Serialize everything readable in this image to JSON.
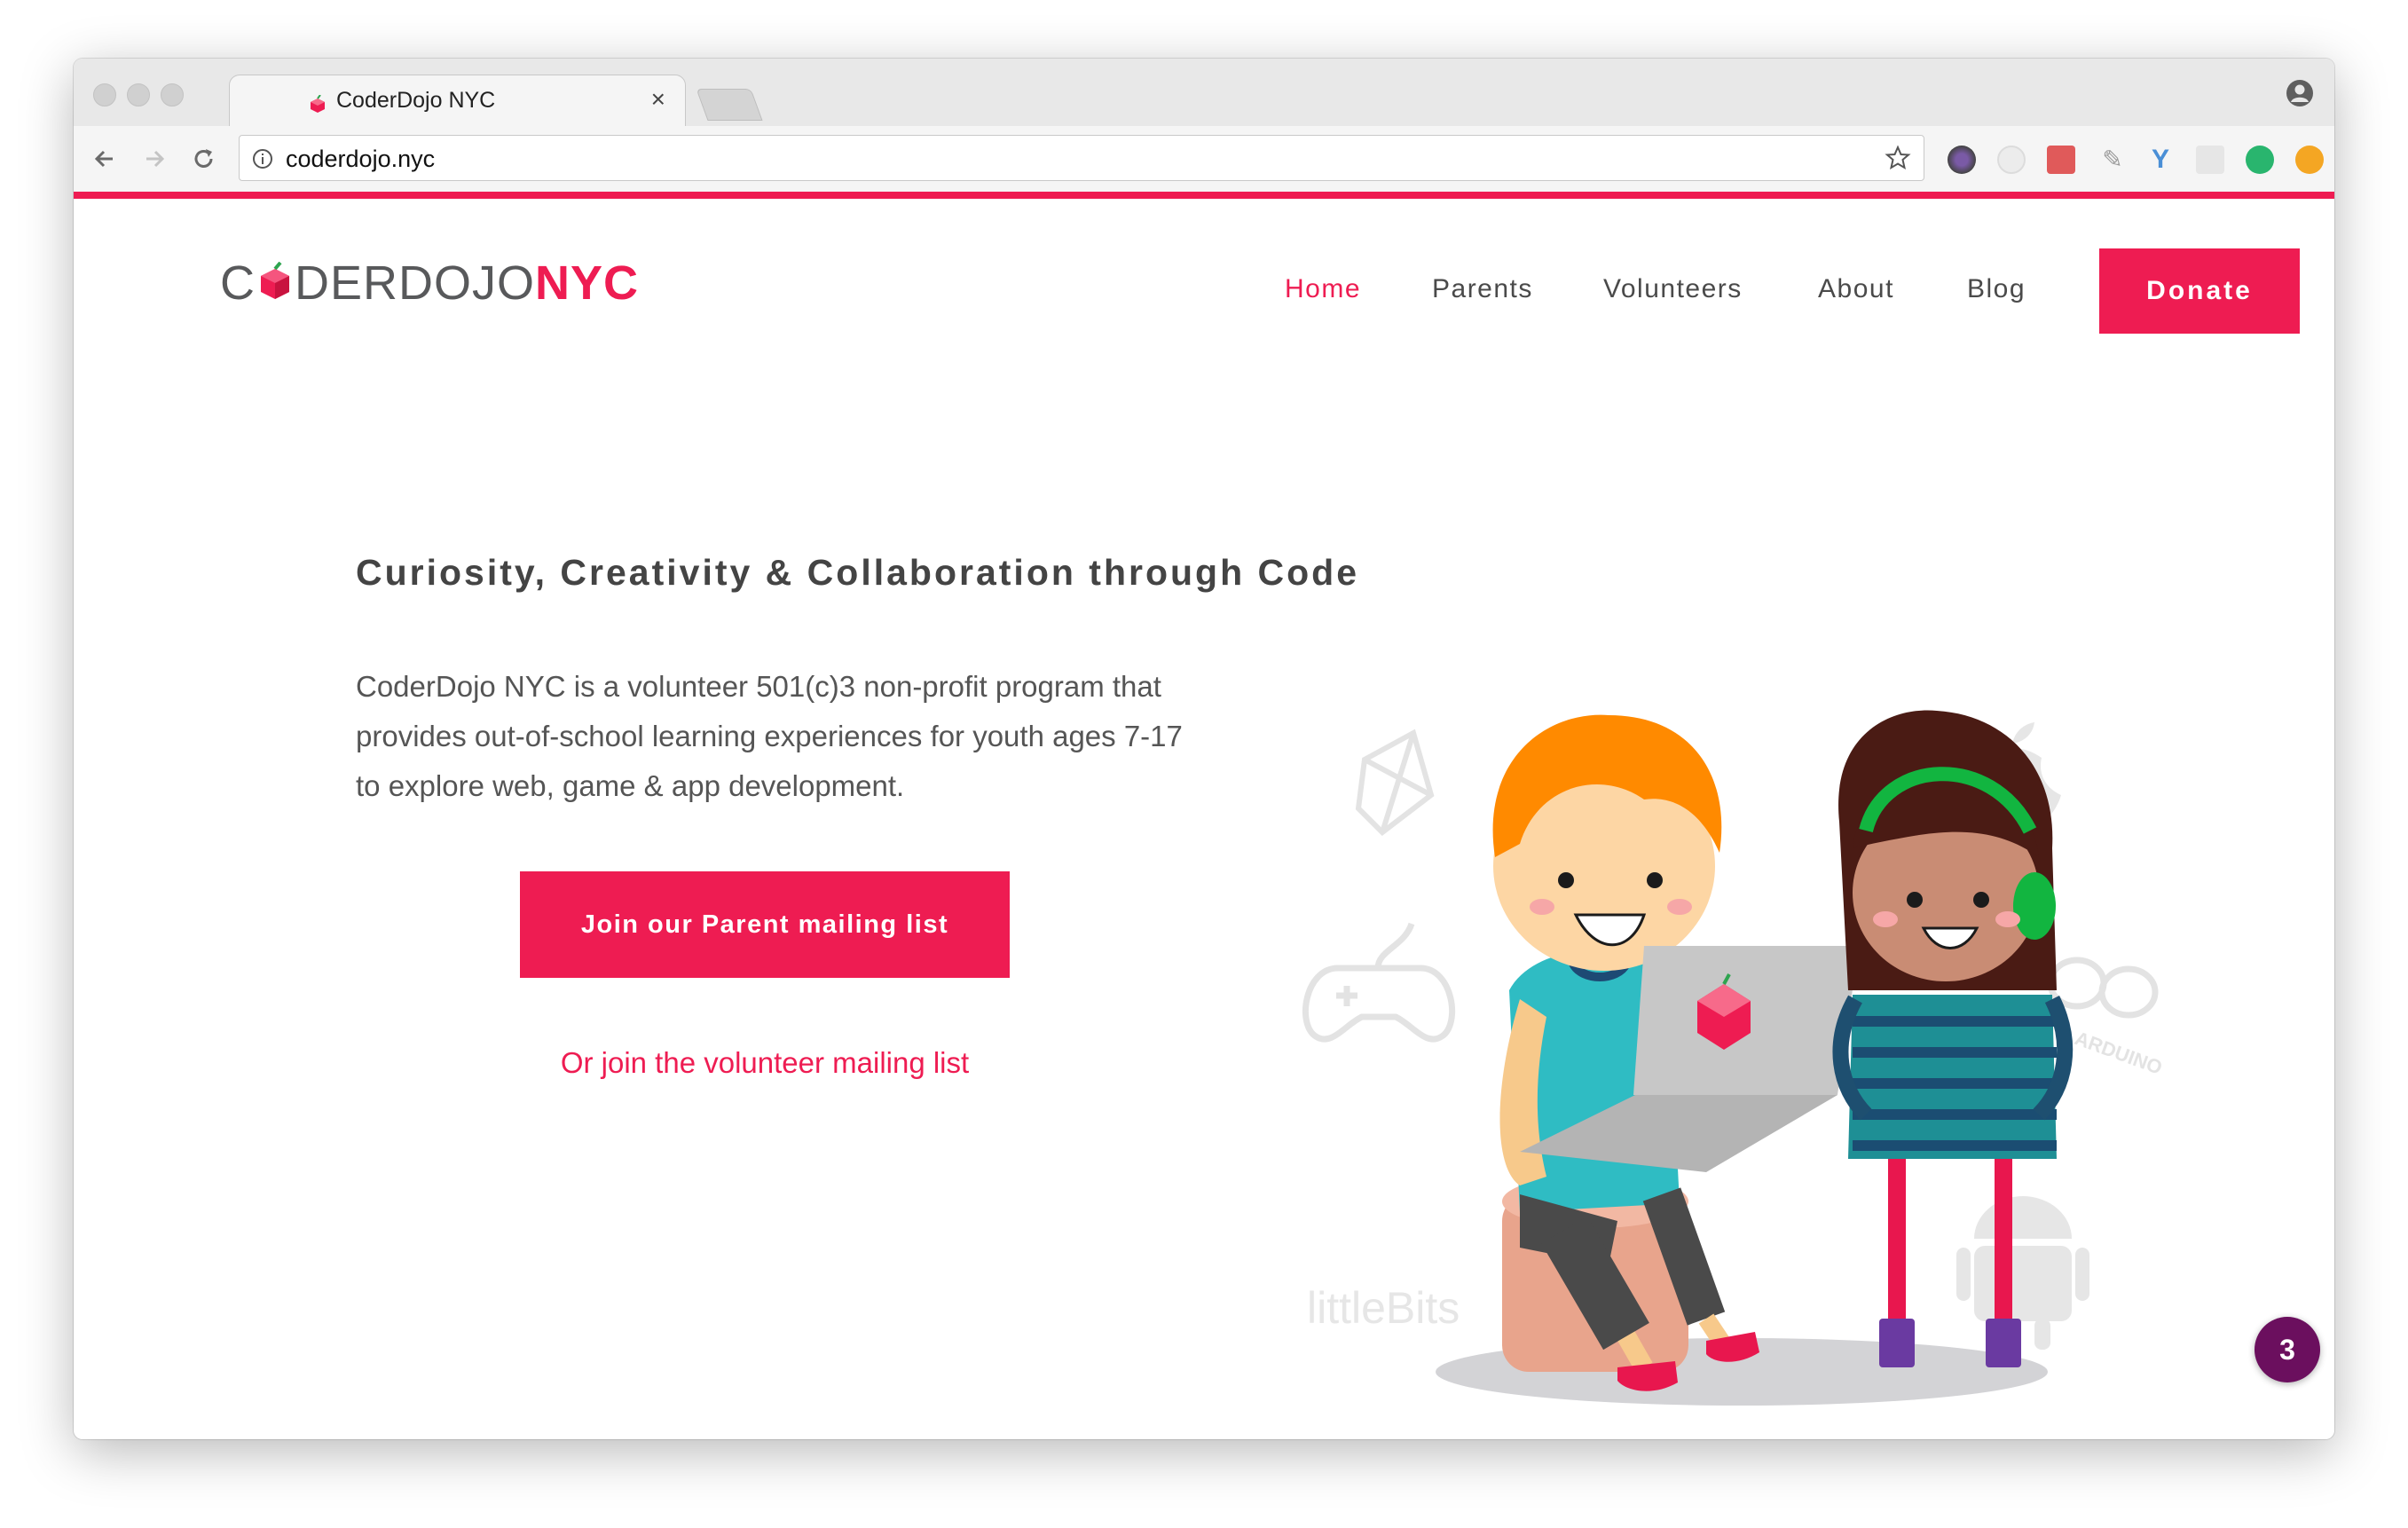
{
  "browser": {
    "tab_title": "CoderDojo NYC",
    "tab_close": "×",
    "url": "coderdojo.nyc"
  },
  "site": {
    "logo": {
      "part1": "C",
      "part2": "DERDOJO",
      "part3": "NYC"
    },
    "nav": {
      "home": "Home",
      "parents": "Parents",
      "volunteers": "Volunteers",
      "about": "About",
      "blog": "Blog",
      "donate": "Donate"
    }
  },
  "hero": {
    "headline": "Curiosity, Creativity & Collaboration through Code",
    "description": "CoderDojo NYC is a volunteer 501(c)3 non-profit program that provides out-of-school learning experiences for youth ages 7-17 to explore web, game & app development.",
    "cta_label": "Join our Parent mailing list",
    "secondary_link": "Or join the volunteer mailing list",
    "illustration_text": "littleBits",
    "arduino_text": "ARDUINO"
  },
  "notification_badge": "3",
  "colors": {
    "accent": "#ee1c52",
    "text_dark": "#444444",
    "badge": "#6b0f5e"
  },
  "icons": [
    "back-arrow-icon",
    "forward-arrow-icon",
    "reload-icon",
    "info-icon",
    "star-icon",
    "profile-icon",
    "favicon-gem-icon"
  ]
}
